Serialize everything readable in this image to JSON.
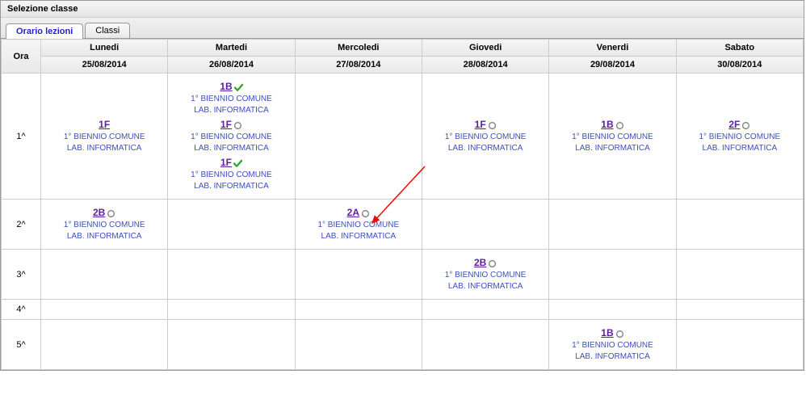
{
  "title": "Selezione classe",
  "tabs": {
    "active": "Orario lezioni",
    "inactive": "Classi"
  },
  "ora_header": "Ora",
  "days": [
    {
      "name": "Lunedi",
      "date": "25/08/2014"
    },
    {
      "name": "Martedi",
      "date": "26/08/2014"
    },
    {
      "name": "Mercoledi",
      "date": "27/08/2014"
    },
    {
      "name": "Giovedi",
      "date": "28/08/2014"
    },
    {
      "name": "Venerdi",
      "date": "29/08/2014"
    },
    {
      "name": "Sabato",
      "date": "30/08/2014"
    }
  ],
  "hours": [
    "1^",
    "2^",
    "3^",
    "4^",
    "5^"
  ],
  "common": {
    "line1": "1° BIENNIO COMUNE",
    "line2": "LAB. INFORMATICA"
  },
  "grid": {
    "0": {
      "0": [
        {
          "class": "1F",
          "icon": ""
        }
      ],
      "1": [
        {
          "class": "1B",
          "icon": "check"
        },
        {
          "class": "1F",
          "icon": "circle"
        },
        {
          "class": "1F",
          "icon": "check"
        }
      ],
      "3": [
        {
          "class": "1F",
          "icon": "circle"
        }
      ],
      "4": [
        {
          "class": "1B",
          "icon": "circle"
        }
      ],
      "5": [
        {
          "class": "2F",
          "icon": "circle"
        }
      ]
    },
    "1": {
      "0": [
        {
          "class": "2B",
          "icon": "circle"
        }
      ],
      "2": [
        {
          "class": "2A",
          "icon": "circle"
        }
      ]
    },
    "2": {
      "3": [
        {
          "class": "2B",
          "icon": "circle"
        }
      ]
    },
    "3": {},
    "4": {
      "4": [
        {
          "class": "1B",
          "icon": "circle"
        }
      ]
    }
  }
}
